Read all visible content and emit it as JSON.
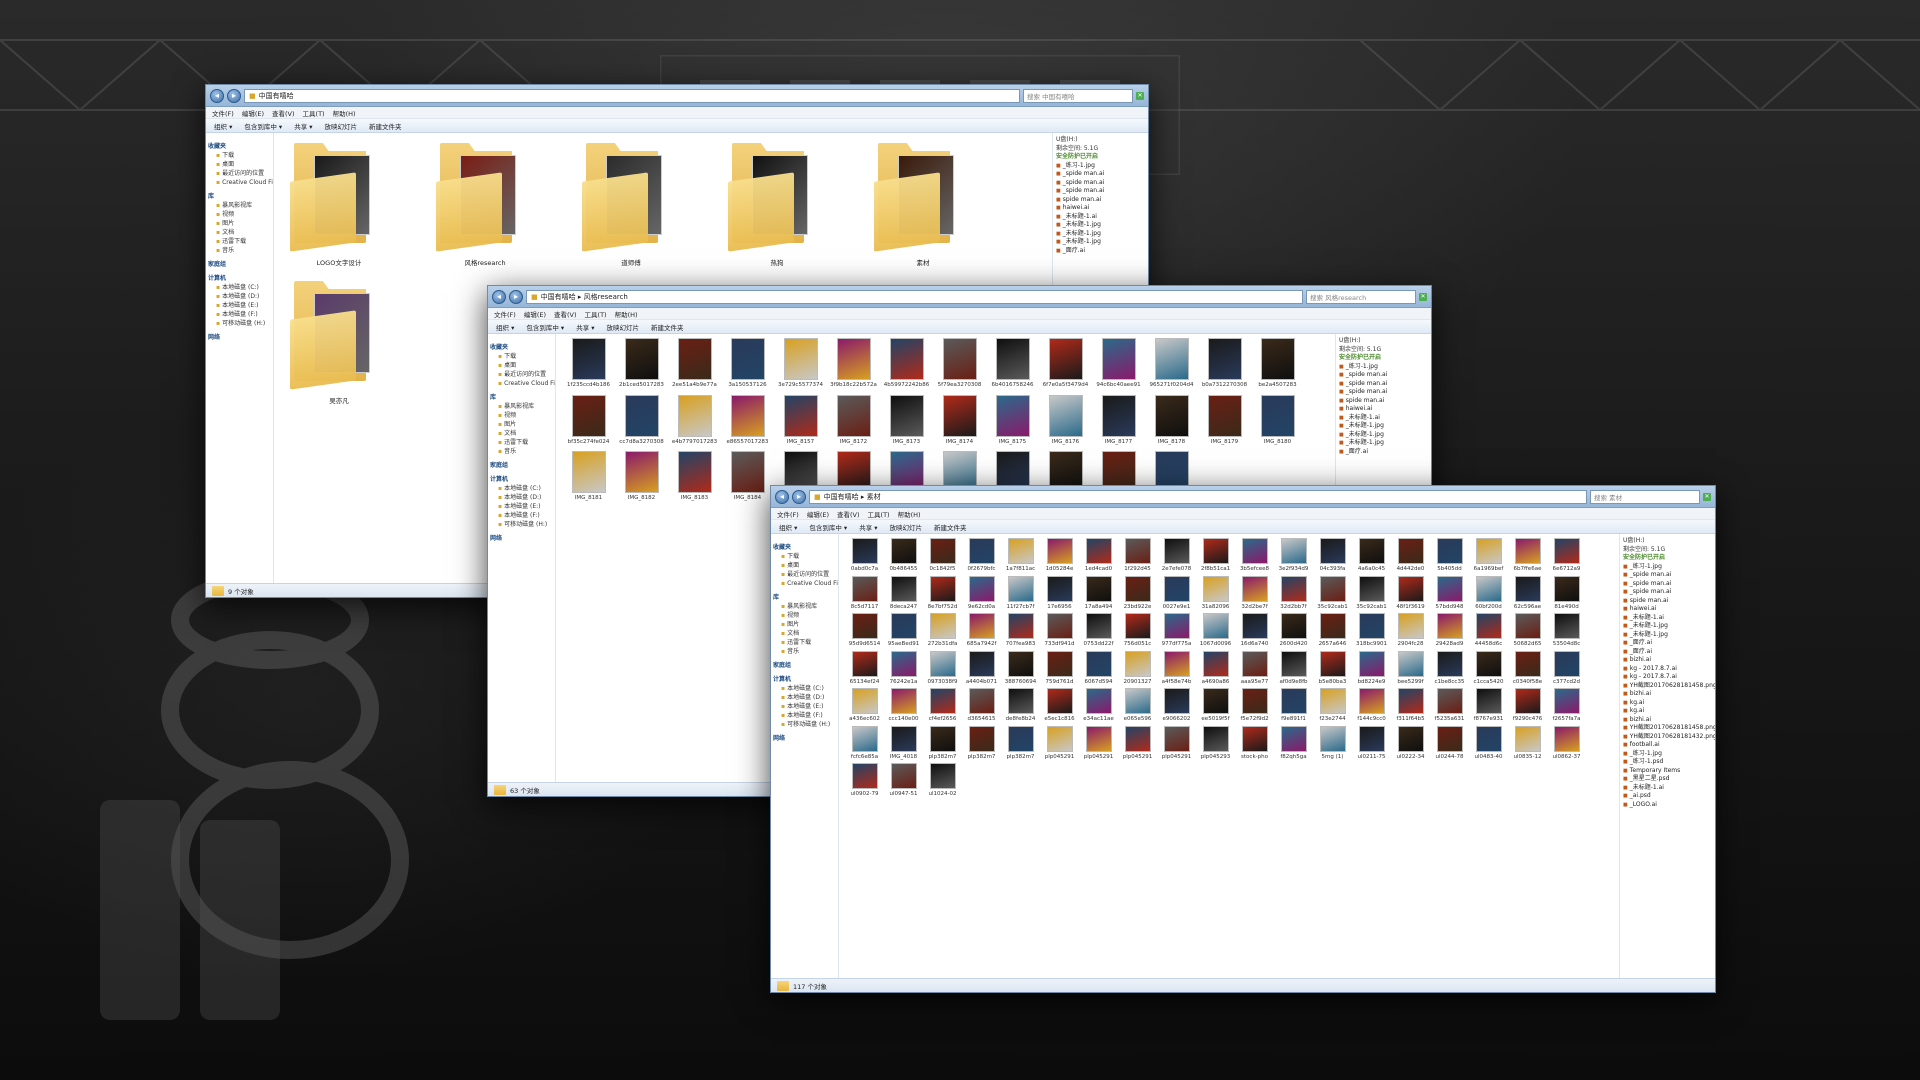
{
  "windows": {
    "main": {
      "path": "中国有嘻哈",
      "menu": [
        "文件(F)",
        "编辑(E)",
        "查看(V)",
        "工具(T)",
        "帮助(H)"
      ],
      "toolbar": [
        "组织 ▾",
        "包含到库中 ▾",
        "共享 ▾",
        "放映幻灯片",
        "新建文件夹"
      ],
      "nav": [
        {
          "group": "收藏夹",
          "items": [
            "下载",
            "桌面",
            "最近访问的位置",
            "Creative Cloud Files"
          ]
        },
        {
          "group": "库",
          "items": [
            "暴风影视库",
            "视频",
            "图片",
            "文档",
            "迅雷下载",
            "音乐"
          ]
        },
        {
          "group": "家庭组",
          "items": []
        },
        {
          "group": "计算机",
          "items": [
            "本地磁盘 (C:)",
            "本地磁盘 (D:)",
            "本地磁盘 (E:)",
            "本地磁盘 (F:)",
            "可移动磁盘 (H:)"
          ]
        },
        {
          "group": "网络",
          "items": []
        }
      ],
      "folders": [
        {
          "label": "LOGO文字设计",
          "tone": "#1a1a1a"
        },
        {
          "label": "风格research",
          "tone": "#7a1d14"
        },
        {
          "label": "道师傅",
          "tone": "#2b2b2b"
        },
        {
          "label": "热狗",
          "tone": "#111111"
        },
        {
          "label": "素材",
          "tone": "#3a1a0a"
        },
        {
          "label": "吴亦凡",
          "tone": "#5a3a6a"
        }
      ],
      "status": "9 个对象"
    },
    "research": {
      "path": "中国有嘻哈 ▸ 风格research",
      "search": "搜索 风格research",
      "menu": [
        "文件(F)",
        "编辑(E)",
        "查看(V)",
        "工具(T)",
        "帮助(H)"
      ],
      "toolbar": [
        "组织 ▾",
        "包含到库中 ▾",
        "共享 ▾",
        "放映幻灯片",
        "新建文件夹"
      ],
      "status": "63 个对象",
      "labels": [
        "1f235ccd4b186",
        "2b1ced5017283",
        "2ee51a4b9e77a",
        "3a150537126",
        "3e729c5577374",
        "3f9b18c22b572a",
        "4b59972242b86",
        "5f79ea3270308",
        "6b4016758246",
        "6f7e0a5f3479d4",
        "94c6bc40aee91",
        "965271f0204d4",
        "b0a7312270308",
        "be2a4507283",
        "bf35c274fe024",
        "cc7d8a3270308",
        "e4b7797017283",
        "e86557017283",
        "IMG_8157",
        "IMG_8172",
        "IMG_8173",
        "IMG_8174",
        "IMG_8175",
        "IMG_8176",
        "IMG_8177",
        "IMG_8178",
        "IMG_8179",
        "IMG_8180",
        "IMG_8181",
        "IMG_8182",
        "IMG_8183",
        "IMG_8184",
        "IMG_8195",
        "IMG_8196",
        "IMG_8197",
        "IMG_8198",
        "手机屏片 2931",
        "手机屏片 3138",
        "手机屏片 3139",
        "手机屏片 31"
      ]
    },
    "materials": {
      "path": "中国有嘻哈 ▸ 素材",
      "search": "搜索 素材",
      "menu": [
        "文件(F)",
        "编辑(E)",
        "查看(V)",
        "工具(T)",
        "帮助(H)"
      ],
      "toolbar": [
        "组织 ▾",
        "包含到库中 ▾",
        "共享 ▾",
        "放映幻灯片",
        "新建文件夹"
      ],
      "status": "117 个对象",
      "labels": [
        "0abd0c7a",
        "0b486455",
        "0c1842f5",
        "0f2679bfc",
        "1a7f811ac",
        "1d05284e",
        "1ed4cad0",
        "1f292d45",
        "2e7efe078",
        "2f8b51ca1",
        "3b5efcee8",
        "3e2f934d9",
        "04c393fa",
        "4a6a0c45",
        "4d442de0",
        "5b405dd",
        "6a1969bef",
        "6b7ffe6ae",
        "6e6712a9",
        "8c5d7117",
        "8deca247",
        "8e7bf752d",
        "9e62cd0a",
        "11f27cb7f",
        "17e6956",
        "17a8a494",
        "23bd922e",
        "0027e9e1",
        "31a82096",
        "32d2be7f",
        "32d2bb7f",
        "35c92cab1",
        "35c92cab1",
        "48f1f3619",
        "57bdd948",
        "60bf200d",
        "62c596ae",
        "81e490d",
        "95d9d6514",
        "95aeBed91",
        "272b31dfa",
        "685a7942f",
        "707fea983",
        "733df941d",
        "0753dd22f",
        "756d051c",
        "977df775a",
        "1067d0096",
        "16d6a740",
        "2600d420",
        "2657a646",
        "318bc9901",
        "2904fc28",
        "29428ad9",
        "44458d6c",
        "50682d65",
        "53504d8c",
        "65134ef24",
        "76242e1a",
        "0973038f9",
        "a4404b071",
        "388760694",
        "759d761d",
        "6067d594",
        "20901327",
        "a4f58e74b",
        "a4690a86",
        "aaa95e77",
        "af0d9e8fb",
        "b5e80ba3",
        "bd8224e9",
        "bee5299f",
        "c1be8cc35",
        "c1cca5420",
        "c0340f58e",
        "c377cd2d",
        "a436ec602",
        "ccc140e00",
        "cf4ef2656",
        "d3654615",
        "de8fe8b24",
        "e5ec1c816",
        "e34ac11ae",
        "e065e596",
        "e9066202",
        "ee5019f5f",
        "f5e72f9d2",
        "f9e891f1",
        "f23e2744",
        "f144c9cc0",
        "f311f64b5",
        "f5235a631",
        "f8767e931",
        "f9290c476",
        "f2657fa7a",
        "fcfc6e85a",
        "IMG_4018",
        "plp382m7",
        "plp382m7",
        "plp382m7",
        "plp045291",
        "plp045291",
        "plp045291",
        "plp045291",
        "plp045293",
        "stock-pho",
        "f82qh5ga",
        "5mg (1)",
        "ul0211-75",
        "ul0222-34",
        "ul0244-78",
        "ul0483-40",
        "ul0835-12",
        "ul0862-37",
        "ul0902-79",
        "ul0947-51",
        "ul1024-02"
      ]
    }
  },
  "preview": {
    "drive": "U盘(H:)",
    "free": "剩余空间: 5.1G",
    "safe": "安全防护已开启",
    "files_a": [
      "_练习-1.jpg",
      "_spide man.ai",
      "_spide man.ai",
      "_spide man.ai",
      "spide man.ai",
      "haiwei.ai",
      "_未标题-1.ai",
      "_未标题-1.jpg",
      "_未标题-1.jpg",
      "_未标题-1.jpg",
      "_面疗.ai"
    ],
    "files_b": [
      "_练习-1.jpg",
      "_spide man.ai",
      "_spide man.ai",
      "_spide man.ai",
      "spide man.ai",
      "haiwei.ai",
      "_未标题-1.ai",
      "_未标题-1.jpg",
      "_未标题-1.jpg",
      "_面疗.ai",
      "_面疗.ai",
      "bizhi.ai",
      "kg - 2017.8.7.ai",
      "kg - 2017.8.7.ai",
      "YH截图20170628181458.png",
      "bizhi.ai",
      "kg.ai",
      "kg.ai",
      "bizhi.ai",
      "YH截图20170628181458.png",
      "YH截图20170628181432.png",
      "football.ai",
      "_练习-1.jpg",
      "_练习-1.psd",
      "Temporary Items",
      "_黑星二星.psd",
      "_未标题-1.ai",
      "_ai.psd",
      "_LOGO.ai"
    ]
  },
  "colors": {
    "thumb_palette": [
      "#1a1a1a",
      "#3a2a1a",
      "#6a1f14",
      "#2a3a5a",
      "#d8a020",
      "#8a1a6a",
      "#224466",
      "#5a5a5a",
      "#0f0f0f",
      "#b02a1a",
      "#2a6a8a",
      "#c8c8c8"
    ]
  }
}
